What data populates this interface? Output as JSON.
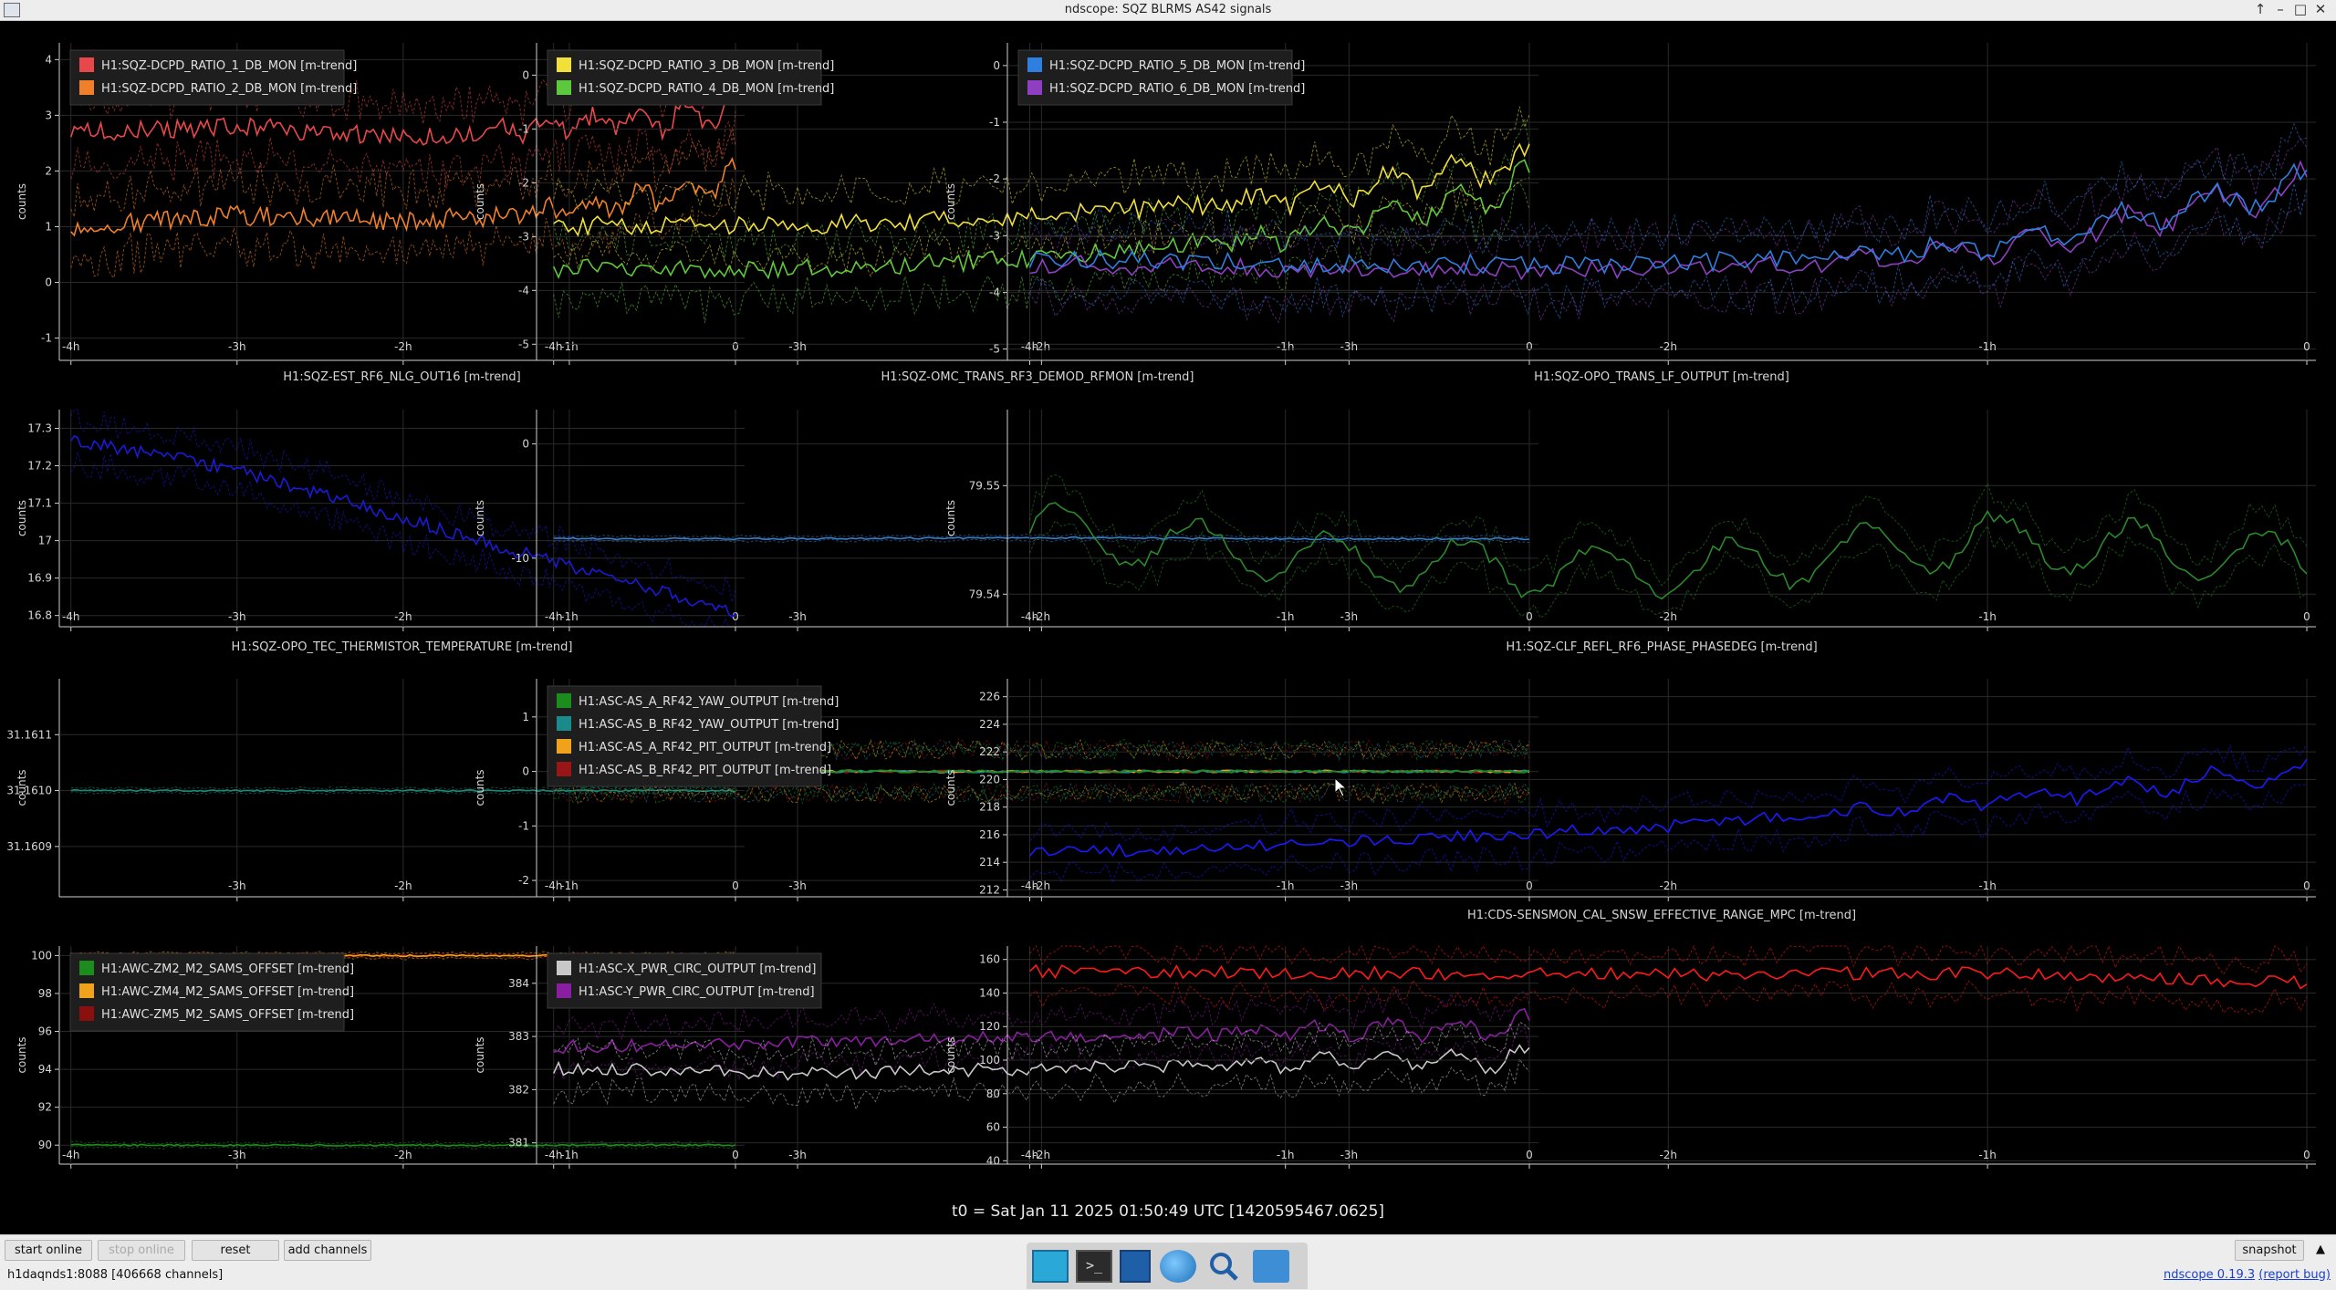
{
  "window": {
    "title": "ndscope: SQZ BLRMS AS42 signals",
    "controls": [
      "↑",
      "–",
      "□",
      "✕"
    ]
  },
  "ylabel": "counts",
  "t0": "t0 = Sat Jan 11 2025 01:50:49 UTC [1420595467.0625]",
  "plots": [
    {
      "title": "",
      "xticks": [
        "-4h",
        "-3h",
        "-2h",
        "-1h",
        "0"
      ],
      "yticks": [
        "4",
        "3",
        "2",
        "1",
        "0",
        "-1"
      ],
      "ylim": [
        -1.4,
        4.3
      ],
      "legend": [
        {
          "label": "H1:SQZ-DCPD_RATIO_1_DB_MON [m-trend]",
          "color": "#e8484a"
        },
        {
          "label": "H1:SQZ-DCPD_RATIO_2_DB_MON [m-trend]",
          "color": "#f07f2a"
        }
      ]
    },
    {
      "title": "",
      "xticks": [
        "-4h",
        "-3h",
        "-2h",
        "-1h",
        "0"
      ],
      "yticks": [
        "0",
        "-1",
        "-2",
        "-3",
        "-4",
        "-5"
      ],
      "ylim": [
        -5.3,
        0.6
      ],
      "legend": [
        {
          "label": "H1:SQZ-DCPD_RATIO_3_DB_MON [m-trend]",
          "color": "#f2e03a"
        },
        {
          "label": "H1:SQZ-DCPD_RATIO_4_DB_MON [m-trend]",
          "color": "#5ec83c"
        }
      ]
    },
    {
      "title": "",
      "xticks": [
        "-4h",
        "-3h",
        "-2h",
        "-1h",
        "0"
      ],
      "yticks": [
        "0",
        "-1",
        "-2",
        "-3",
        "-4",
        "-5"
      ],
      "ylim": [
        -5.2,
        0.4
      ],
      "legend": [
        {
          "label": "H1:SQZ-DCPD_RATIO_5_DB_MON [m-trend]",
          "color": "#2f7fe0"
        },
        {
          "label": "H1:SQZ-DCPD_RATIO_6_DB_MON [m-trend]",
          "color": "#8e3fc2"
        }
      ]
    },
    {
      "title": "H1:SQZ-EST_RF6_NLG_OUT16 [m-trend]",
      "xticks": [
        "-4h",
        "-3h",
        "-2h",
        "-1h",
        "0"
      ],
      "yticks": [
        "17.3",
        "17.2",
        "17.1",
        "17",
        "16.9",
        "16.8"
      ],
      "ylim": [
        16.77,
        17.35
      ],
      "legend": []
    },
    {
      "title": "H1:SQZ-OMC_TRANS_RF3_DEMOD_RFMON [m-trend]",
      "xticks": [
        "-4h",
        "-3h",
        "-2h",
        "-1h",
        "0"
      ],
      "yticks": [
        "0",
        "-10"
      ],
      "ylim": [
        -16,
        3
      ],
      "legend": []
    },
    {
      "title": "H1:SQZ-OPO_TRANS_LF_OUTPUT [m-trend]",
      "xticks": [
        "-4h",
        "-3h",
        "-2h",
        "-1h",
        "0"
      ],
      "yticks": [
        "79.55",
        "79.54"
      ],
      "ylim": [
        79.537,
        79.557
      ],
      "legend": []
    },
    {
      "title": "H1:SQZ-OPO_TEC_THERMISTOR_TEMPERATURE [m-trend]",
      "xticks": [
        "-3h",
        "-2h",
        "-1h",
        "0"
      ],
      "yticks": [
        "31.1611",
        "31.1610",
        "31.1609"
      ],
      "ylim": [
        31.16081,
        31.1612
      ],
      "legend": []
    },
    {
      "title": "",
      "xticks": [
        "-4h",
        "-3h",
        "-2h",
        "-1h",
        "0"
      ],
      "yticks": [
        "1",
        "0",
        "-1",
        "-2"
      ],
      "ylim": [
        -2.3,
        1.7
      ],
      "legend": [
        {
          "label": "H1:ASC-AS_A_RF42_YAW_OUTPUT [m-trend]",
          "color": "#1c8c1c"
        },
        {
          "label": "H1:ASC-AS_B_RF42_YAW_OUTPUT [m-trend]",
          "color": "#1a8a8a"
        },
        {
          "label": "H1:ASC-AS_A_RF42_PIT_OUTPUT [m-trend]",
          "color": "#f0a21a"
        },
        {
          "label": "H1:ASC-AS_B_RF42_PIT_OUTPUT [m-trend]",
          "color": "#9a1515"
        }
      ]
    },
    {
      "title": "H1:SQZ-CLF_REFL_RF6_PHASE_PHASEDEG [m-trend]",
      "xticks": [
        "-4h",
        "-3h",
        "-2h",
        "-1h",
        "0"
      ],
      "yticks": [
        "226",
        "224",
        "222",
        "220",
        "218",
        "216",
        "214",
        "212"
      ],
      "ylim": [
        211.5,
        227.3
      ],
      "legend": []
    },
    {
      "title": "",
      "xticks": [
        "-4h",
        "-3h",
        "-2h",
        "-1h",
        "0"
      ],
      "yticks": [
        "100",
        "98",
        "96",
        "94",
        "92",
        "90"
      ],
      "ylim": [
        89,
        100.5
      ],
      "legend": [
        {
          "label": "H1:AWC-ZM2_M2_SAMS_OFFSET [m-trend]",
          "color": "#1c8c1c"
        },
        {
          "label": "H1:AWC-ZM4_M2_SAMS_OFFSET [m-trend]",
          "color": "#f0a21a"
        },
        {
          "label": "H1:AWC-ZM5_M2_SAMS_OFFSET [m-trend]",
          "color": "#8a1010"
        }
      ]
    },
    {
      "title": "",
      "xticks": [
        "-4h",
        "-3h",
        "-2h",
        "-1h",
        "0"
      ],
      "yticks": [
        "384",
        "383",
        "382",
        "381"
      ],
      "ylim": [
        380.6,
        384.7
      ],
      "legend": [
        {
          "label": "H1:ASC-X_PWR_CIRC_OUTPUT [m-trend]",
          "color": "#c8c8c8"
        },
        {
          "label": "H1:ASC-Y_PWR_CIRC_OUTPUT [m-trend]",
          "color": "#8a1ea0"
        }
      ]
    },
    {
      "title": "H1:CDS-SENSMON_CAL_SNSW_EFFECTIVE_RANGE_MPC [m-trend]",
      "xticks": [
        "-4h",
        "-3h",
        "-2h",
        "-1h",
        "0"
      ],
      "yticks": [
        "160",
        "140",
        "120",
        "100",
        "80",
        "60",
        "40"
      ],
      "ylim": [
        38,
        168
      ],
      "legend": []
    }
  ],
  "chart_data": [
    {
      "type": "line",
      "x": [
        -4,
        -3,
        -2,
        -1,
        0
      ],
      "series": [
        {
          "name": "H1:SQZ-DCPD_RATIO_1_DB_MON [m-trend]",
          "values": [
            2.7,
            2.8,
            2.6,
            2.8,
            3.1
          ]
        },
        {
          "name": "H1:SQZ-DCPD_RATIO_2_DB_MON [m-trend]",
          "values": [
            1.0,
            1.2,
            1.1,
            1.3,
            1.8
          ]
        }
      ]
    },
    {
      "type": "line",
      "x": [
        -4,
        -3,
        -2,
        -1,
        0
      ],
      "series": [
        {
          "name": "H1:SQZ-DCPD_RATIO_3_DB_MON [m-trend]",
          "values": [
            -2.8,
            -2.8,
            -2.6,
            -2.3,
            -1.6
          ]
        },
        {
          "name": "H1:SQZ-DCPD_RATIO_4_DB_MON [m-trend]",
          "values": [
            -3.6,
            -3.6,
            -3.4,
            -3.0,
            -2.0
          ]
        }
      ]
    },
    {
      "type": "line",
      "x": [
        -4,
        -3,
        -2,
        -1,
        0
      ],
      "series": [
        {
          "name": "H1:SQZ-DCPD_RATIO_5_DB_MON [m-trend]",
          "values": [
            -3.4,
            -3.5,
            -3.5,
            -3.2,
            -2.1
          ]
        },
        {
          "name": "H1:SQZ-DCPD_RATIO_6_DB_MON [m-trend]",
          "values": [
            -3.5,
            -3.6,
            -3.6,
            -3.3,
            -2.1
          ]
        }
      ]
    },
    {
      "type": "line",
      "x": [
        -4,
        -3,
        -2,
        -1,
        0
      ],
      "series": [
        {
          "values": [
            17.27,
            17.19,
            17.06,
            16.93,
            16.81
          ]
        }
      ]
    },
    {
      "type": "line",
      "x": [
        -4,
        -3,
        -2,
        -1,
        0
      ],
      "series": [
        {
          "values": [
            -8.3,
            -8.3,
            -8.2,
            -8.3,
            -8.3
          ]
        }
      ]
    },
    {
      "type": "line",
      "x": [
        -4,
        -3,
        -2,
        -1,
        0
      ],
      "series": [
        {
          "values": [
            79.546,
            79.543,
            79.542,
            79.545,
            79.543
          ]
        }
      ]
    },
    {
      "type": "line",
      "x": [
        -4,
        -3,
        -2,
        -1,
        0
      ],
      "series": [
        {
          "values": [
            31.161,
            31.161,
            31.161,
            31.161,
            31.161
          ]
        }
      ]
    },
    {
      "type": "line",
      "x": [
        -4,
        -3,
        -2,
        -1,
        0
      ],
      "series": [
        {
          "name": "H1:ASC-AS_A_RF42_YAW_OUTPUT [m-trend]",
          "values": [
            0,
            0,
            0,
            0,
            0
          ]
        },
        {
          "name": "H1:ASC-AS_B_RF42_YAW_OUTPUT [m-trend]",
          "values": [
            0,
            0,
            0,
            0,
            0
          ]
        },
        {
          "name": "H1:ASC-AS_A_RF42_PIT_OUTPUT [m-trend]",
          "values": [
            0,
            0,
            0,
            0,
            0
          ]
        },
        {
          "name": "H1:ASC-AS_B_RF42_PIT_OUTPUT [m-trend]",
          "values": [
            0,
            0,
            0,
            0,
            0
          ]
        }
      ]
    },
    {
      "type": "line",
      "x": [
        -4,
        -3,
        -2,
        -1,
        0
      ],
      "series": [
        {
          "values": [
            214.6,
            215.5,
            216.6,
            218.5,
            220.5
          ]
        }
      ]
    },
    {
      "type": "line",
      "x": [
        -4,
        -3,
        -2,
        -1,
        0
      ],
      "series": [
        {
          "name": "H1:AWC-ZM2_M2_SAMS_OFFSET [m-trend]",
          "values": [
            90,
            90,
            90,
            90,
            90
          ]
        },
        {
          "name": "H1:AWC-ZM4_M2_SAMS_OFFSET [m-trend]",
          "values": [
            100,
            100,
            100,
            100,
            100
          ]
        },
        {
          "name": "H1:AWC-ZM5_M2_SAMS_OFFSET [m-trend]",
          "values": [
            100,
            100,
            100,
            100,
            100
          ]
        }
      ]
    },
    {
      "type": "line",
      "x": [
        -4,
        -3,
        -2,
        -1,
        0
      ],
      "series": [
        {
          "name": "H1:ASC-X_PWR_CIRC_OUTPUT [m-trend]",
          "values": [
            382.4,
            382.3,
            382.4,
            382.5,
            382.6
          ]
        },
        {
          "name": "H1:ASC-Y_PWR_CIRC_OUTPUT [m-trend]",
          "values": [
            382.8,
            382.9,
            383.0,
            383.1,
            383.2
          ]
        }
      ]
    },
    {
      "type": "line",
      "x": [
        -4,
        -3,
        -2,
        -1,
        0
      ],
      "series": [
        {
          "values": [
            153,
            152,
            151,
            152,
            146
          ]
        }
      ]
    }
  ],
  "buttons": {
    "start_online": "start online",
    "stop_online": "stop online",
    "reset": "reset",
    "add_channels": "add channels",
    "snapshot": "snapshot",
    "expand": "▲"
  },
  "status": {
    "server": "h1daqnds1:8088  [406668 channels]",
    "version": "ndscope 0.19.3",
    "report": "(report bug)"
  },
  "dock": [
    "desktop-icon",
    "terminal-icon",
    "text-editor-icon",
    "browser-icon",
    "search-icon",
    "folder-icon"
  ]
}
